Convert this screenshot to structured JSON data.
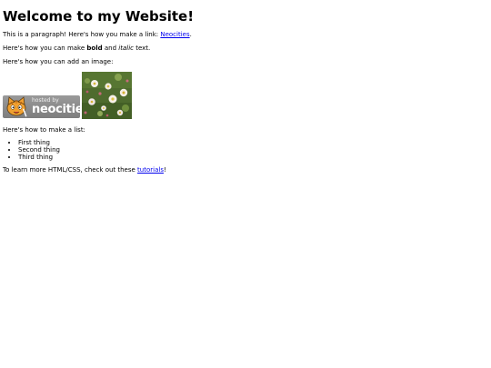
{
  "heading": "Welcome to my Website!",
  "para_link": {
    "before": "This is a paragraph! Here's how you make a link: ",
    "link": "Neocities",
    "after": "."
  },
  "para_format": {
    "before": "Here's how you can make ",
    "bold": "bold",
    "middle": " and ",
    "italic": "italic",
    "after": " text."
  },
  "para_image": "Here's how you can add an image:",
  "badge": {
    "small_text": "hosted by",
    "brand_text": "neocities"
  },
  "para_list": "Here's how to make a list:",
  "list_items": [
    "First thing",
    "Second thing",
    "Third thing"
  ],
  "para_learn": {
    "before": "To learn more HTML/CSS, check out these ",
    "link": "tutorials",
    "after": "!"
  }
}
